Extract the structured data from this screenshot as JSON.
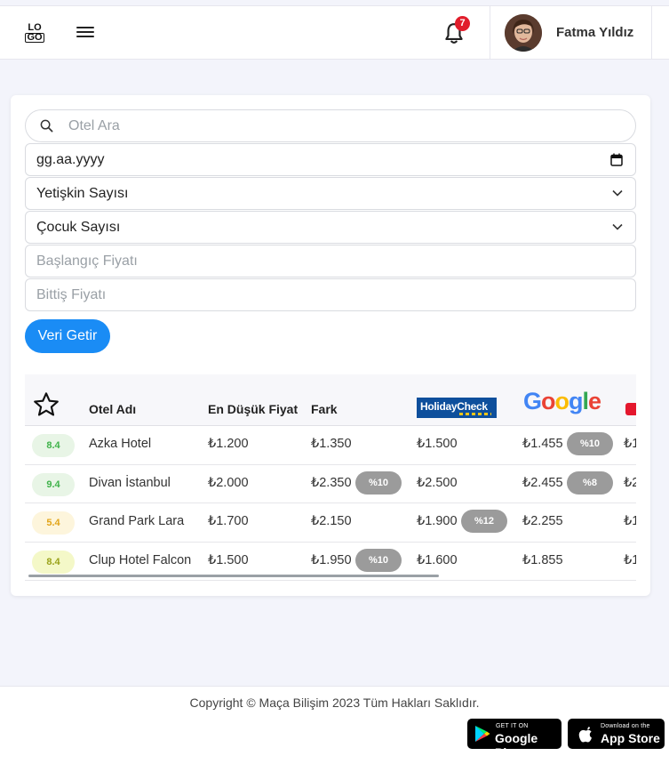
{
  "header": {
    "logo": [
      "LO",
      "GO"
    ],
    "notifications": "7",
    "user_name": "Fatma Yıldız"
  },
  "form": {
    "search_placeholder": "Otel Ara",
    "date_value": "gg.aa.yyyy",
    "adults_label": "Yetişkin Sayısı",
    "children_label": "Çocuk Sayısı",
    "min_price_placeholder": "Başlangıç Fiyatı",
    "max_price_placeholder": "Bittiş Fiyatı",
    "submit_label": "Veri Getir"
  },
  "table": {
    "headers": [
      "Otel Adı",
      "En Düşük Fiyat",
      "Fark"
    ],
    "providers": [
      "HolidayCheck",
      "Google"
    ],
    "rows": [
      {
        "score": "8.4",
        "name": "Azka Hotel",
        "min": "₺1.200",
        "fark": "₺1.350",
        "fark_pct": "",
        "hc": "₺1.500",
        "hc_pct": "",
        "google": "₺1.455",
        "google_pct": "%10",
        "next": "₺1",
        "score_bg": "#e8f5e6",
        "score_fg": "#3fb34a"
      },
      {
        "score": "9.4",
        "name": "Divan İstanbul",
        "min": "₺2.000",
        "fark": "₺2.350",
        "fark_pct": "%10",
        "hc": "₺2.500",
        "hc_pct": "",
        "google": "₺2.455",
        "google_pct": "%8",
        "next": "₺2",
        "score_bg": "#e8f5e6",
        "score_fg": "#3fb34a"
      },
      {
        "score": "5.4",
        "name": "Grand Park Lara",
        "min": "₺1.700",
        "fark": "₺2.150",
        "fark_pct": "",
        "hc": "₺1.900",
        "hc_pct": "%12",
        "google": "₺2.255",
        "google_pct": "",
        "next": "₺1",
        "score_bg": "#fdf5dc",
        "score_fg": "#e2a51a"
      },
      {
        "score": "8.4",
        "name": "Clup Hotel Falcon",
        "min": "₺1.500",
        "fark": "₺1.950",
        "fark_pct": "%10",
        "hc": "₺1.600",
        "hc_pct": "",
        "google": "₺1.855",
        "google_pct": "",
        "next": "₺1",
        "score_bg": "#f4f8c8",
        "score_fg": "#9aa21a"
      }
    ]
  },
  "footer": {
    "copyright": "Copyright © Maça Bilişim 2023 Tüm Hakları Saklıdır.",
    "google_small": "GET IT ON",
    "google_big": "Google Play",
    "apple_small": "Download on the",
    "apple_big": "App Store"
  }
}
